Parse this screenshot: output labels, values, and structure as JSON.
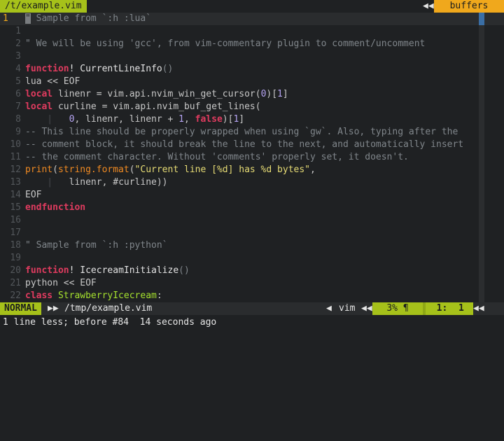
{
  "tabline": {
    "active_tab": "/t/example.vim",
    "arrows": "◀◀",
    "buffers_label": "buffers"
  },
  "editor": {
    "lines": [
      {
        "n": "1",
        "current": true,
        "tokens": [
          [
            "cursor",
            "\""
          ],
          [
            "com",
            " Sample from `:h :lua`"
          ]
        ]
      },
      {
        "n": "1",
        "tokens": []
      },
      {
        "n": "2",
        "tokens": [
          [
            "com",
            "\" We will be using 'gcc', from vim-commentary plugin to comment/uncomment"
          ]
        ]
      },
      {
        "n": "3",
        "tokens": []
      },
      {
        "n": "4",
        "tokens": [
          [
            "kw",
            "function"
          ],
          [
            "fn",
            "! CurrentLineInfo"
          ],
          [
            "com",
            "()"
          ]
        ]
      },
      {
        "n": "5",
        "tokens": [
          [
            "txt",
            "lua << EOF"
          ]
        ]
      },
      {
        "n": "6",
        "tokens": [
          [
            "kw",
            "local"
          ],
          [
            "txt",
            " linenr = vim.api.nvim_win_get_cursor("
          ],
          [
            "num",
            "0"
          ],
          [
            "txt",
            ")["
          ],
          [
            "num",
            "1"
          ],
          [
            "txt",
            "]"
          ]
        ]
      },
      {
        "n": "7",
        "tokens": [
          [
            "kw",
            "local"
          ],
          [
            "txt",
            " curline = vim.api.nvim_buf_get_lines("
          ]
        ]
      },
      {
        "n": "8",
        "tokens": [
          [
            "guide",
            "    |   "
          ],
          [
            "num",
            "0"
          ],
          [
            "txt",
            ", linenr, linenr + "
          ],
          [
            "num",
            "1"
          ],
          [
            "txt",
            ", "
          ],
          [
            "kw",
            "false"
          ],
          [
            "txt",
            ")["
          ],
          [
            "num",
            "1"
          ],
          [
            "txt",
            "]"
          ]
        ]
      },
      {
        "n": "9",
        "tokens": [
          [
            "com",
            "-- This line should be properly wrapped when using `gw`. Also, typing after the"
          ]
        ]
      },
      {
        "n": "10",
        "tokens": [
          [
            "com",
            "-- comment block, it should break the line to the next, and automatically insert"
          ]
        ]
      },
      {
        "n": "11",
        "tokens": [
          [
            "com",
            "-- the comment character. Without 'comments' properly set, it doesn't."
          ]
        ]
      },
      {
        "n": "12",
        "tokens": [
          [
            "bi",
            "print"
          ],
          [
            "txt",
            "("
          ],
          [
            "bi",
            "string.format"
          ],
          [
            "txt",
            "("
          ],
          [
            "str",
            "\"Current line [%d] has %d bytes\""
          ],
          [
            "txt",
            ","
          ]
        ]
      },
      {
        "n": "13",
        "tokens": [
          [
            "guide",
            "    |   "
          ],
          [
            "txt",
            "linenr, #curline))"
          ]
        ]
      },
      {
        "n": "14",
        "tokens": [
          [
            "txt",
            "EOF"
          ]
        ]
      },
      {
        "n": "15",
        "tokens": [
          [
            "kw",
            "endfunction"
          ]
        ]
      },
      {
        "n": "16",
        "tokens": []
      },
      {
        "n": "17",
        "tokens": []
      },
      {
        "n": "18",
        "tokens": [
          [
            "com",
            "\" Sample from `:h :python`"
          ]
        ]
      },
      {
        "n": "19",
        "tokens": []
      },
      {
        "n": "20",
        "tokens": [
          [
            "kw",
            "function"
          ],
          [
            "fn",
            "! IcecreamInitialize"
          ],
          [
            "com",
            "()"
          ]
        ]
      },
      {
        "n": "21",
        "tokens": [
          [
            "txt",
            "python << EOF"
          ]
        ]
      },
      {
        "n": "22",
        "tokens": [
          [
            "kw",
            "class"
          ],
          [
            "cls",
            " StrawberryIcecream"
          ],
          [
            "txt",
            ":"
          ]
        ]
      }
    ]
  },
  "statusline": {
    "mode": "NORMAL",
    "arrow": "▶▶",
    "path": "/tmp/example.vim",
    "filetype_arrow": "◀",
    "filetype": "vim",
    "pos_arrow": "◀◀",
    "percent": "3% ¶",
    "line_col": "  1:  1",
    "end_arrow": "◀◀"
  },
  "cmdline": {
    "message": "1 line less; before #84  14 seconds ago"
  },
  "colors": {
    "accent_green": "#a6c11a",
    "accent_orange": "#f0a81c",
    "background": "#1f2123",
    "keyword": "#e03b5f",
    "comment": "#80868b",
    "number": "#b5a4f2",
    "string": "#e6db74",
    "builtin": "#f08a22"
  }
}
